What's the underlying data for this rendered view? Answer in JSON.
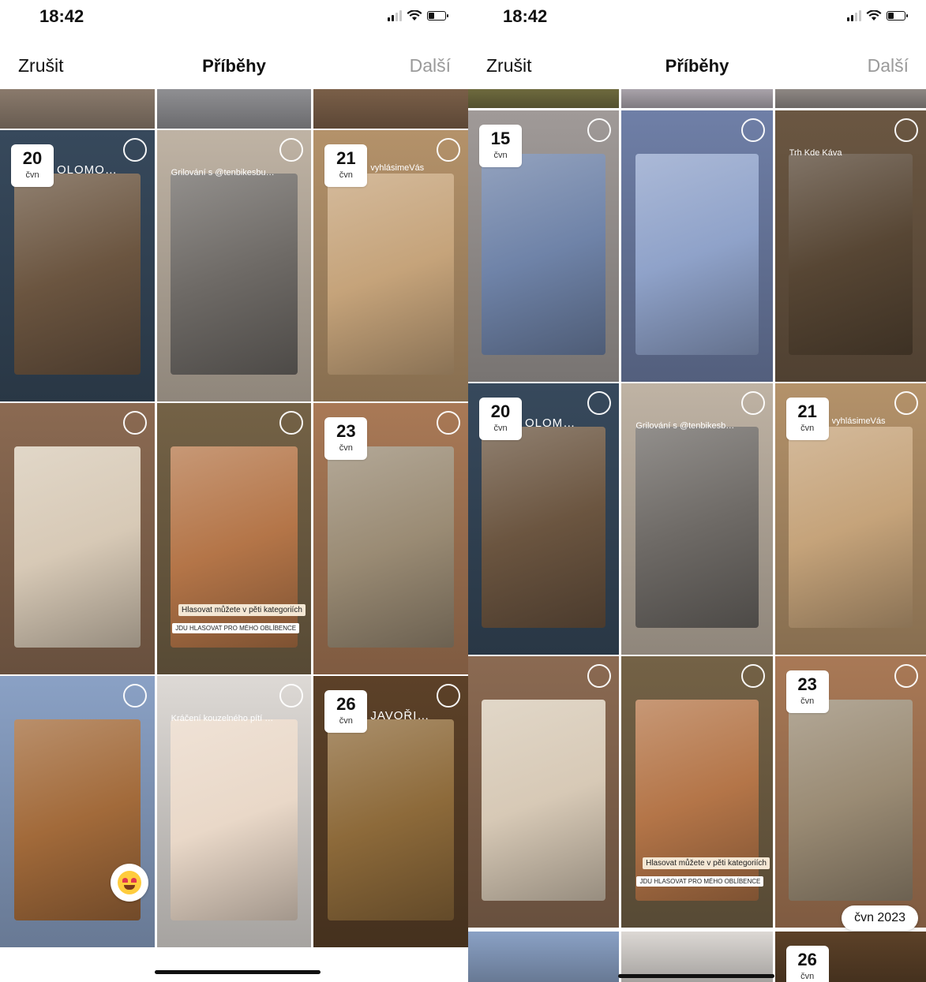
{
  "left": {
    "time": "18:42",
    "nav": {
      "cancel": "Zrušit",
      "title": "Příběhy",
      "next": "Další"
    },
    "tiles": [
      {
        "name": "story-tile-top-1",
        "bg": "#8a7a6c"
      },
      {
        "name": "story-tile-top-2",
        "bg": "#8f8f92"
      },
      {
        "name": "story-tile-top-3",
        "bg": "#7a5f48"
      },
      {
        "name": "story-tile-olomouc-bridge",
        "bg": "#37495c",
        "photo": "#6b5540",
        "day": "20",
        "month": "čvn",
        "caption": "OLOMOUC"
      },
      {
        "name": "story-tile-burger",
        "bg": "#bfb3a4",
        "photo": "#6e6a66",
        "caption": "Grilování s @tenbikesburgrom"
      },
      {
        "name": "story-tile-office",
        "bg": "#b4926a",
        "photo": "#c5a37a",
        "day": "21",
        "month": "čvn",
        "caption": "vyhlásimeVás"
      },
      {
        "name": "story-tile-magazine",
        "bg": "#8b6a52",
        "photo": "#d7c9b6"
      },
      {
        "name": "story-tile-kangaroo",
        "bg": "#746246",
        "photo": "#b47548",
        "tag1": "Hlasovat můžete v pěti kategoriích",
        "tag2": "JDU HLASOVAT PRO MÉHO OBLÍBENCE"
      },
      {
        "name": "story-tile-dinner",
        "bg": "#a97956",
        "photo": "#9a8b74",
        "day": "23",
        "month": "čvn"
      },
      {
        "name": "story-tile-castle-sunset",
        "bg": "#8aa1c5",
        "photo": "#a26a3a"
      },
      {
        "name": "story-tile-spa",
        "bg": "#ddd9d5",
        "photo": "#e9d8c8",
        "caption": "Kráčení kouzelného pítí v oblasti Lišíkových lázní"
      },
      {
        "name": "story-tile-cave",
        "bg": "#5c4128",
        "photo": "#8d6a3a",
        "day": "26",
        "month": "čvn",
        "caption": "JAVOŘIČSKÉ JESKYNĚ"
      }
    ]
  },
  "right": {
    "time": "18:42",
    "nav": {
      "cancel": "Zrušit",
      "title": "Příběhy",
      "next": "Další"
    },
    "month_pill": "čvn 2023",
    "tiles": [
      {
        "name": "story-tile-top-1",
        "bg": "#6e6a3e"
      },
      {
        "name": "story-tile-top-2",
        "bg": "#a9a3aa"
      },
      {
        "name": "story-tile-top-3",
        "bg": "#8e8884"
      },
      {
        "name": "story-tile-collage",
        "bg": "#a09a98",
        "photo": "#6f83a8",
        "day": "15",
        "month": "čvn"
      },
      {
        "name": "story-tile-tortoise",
        "bg": "#6f7fa7",
        "photo": "#8fa2c9"
      },
      {
        "name": "story-tile-coffee-shop",
        "bg": "#6b5742",
        "photo": "#574634",
        "caption": "Trh Kde Káva"
      },
      {
        "name": "story-tile-olomouc-bridge",
        "bg": "#37495c",
        "photo": "#6b5540",
        "day": "20",
        "month": "čvn",
        "caption": "OLOMOUC"
      },
      {
        "name": "story-tile-burger",
        "bg": "#bfb3a4",
        "photo": "#6e6a66",
        "caption": "Grilování s @tenbikesburgrom"
      },
      {
        "name": "story-tile-office",
        "bg": "#b4926a",
        "photo": "#c5a37a",
        "day": "21",
        "month": "čvn",
        "caption": "vyhlásimeVás"
      },
      {
        "name": "story-tile-magazine",
        "bg": "#8b6a52",
        "photo": "#d7c9b6"
      },
      {
        "name": "story-tile-kangaroo",
        "bg": "#746246",
        "photo": "#b47548",
        "tag1": "Hlasovat můžete v pěti kategoriích",
        "tag2": "JDU HLASOVAT PRO MÉHO OBLÍBENCE"
      },
      {
        "name": "story-tile-dinner",
        "bg": "#a97956",
        "photo": "#9a8b74",
        "day": "23",
        "month": "čvn"
      },
      {
        "name": "story-tile-bottom-1",
        "bg": "#8aa1c5"
      },
      {
        "name": "story-tile-bottom-2",
        "bg": "#dcd8d4"
      },
      {
        "name": "story-tile-bottom-3",
        "bg": "#5c4128",
        "day": "26",
        "month": "čvn"
      }
    ]
  }
}
